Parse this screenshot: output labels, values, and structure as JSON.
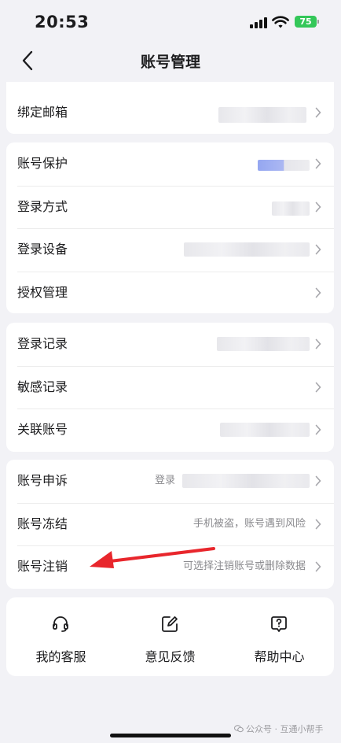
{
  "status_bar": {
    "time": "20:53",
    "battery": "75"
  },
  "nav": {
    "title": "账号管理"
  },
  "section_email": {
    "items": [
      {
        "label": "绑定邮箱",
        "value": ""
      }
    ]
  },
  "section_security": {
    "items": [
      {
        "label": "账号保护",
        "value": ""
      },
      {
        "label": "登录方式",
        "value": ""
      },
      {
        "label": "登录设备",
        "value": ""
      },
      {
        "label": "授权管理",
        "value": ""
      }
    ]
  },
  "section_records": {
    "items": [
      {
        "label": "登录记录",
        "value": ""
      },
      {
        "label": "敏感记录",
        "value": ""
      },
      {
        "label": "关联账号",
        "value": ""
      }
    ]
  },
  "section_account": {
    "items": [
      {
        "label": "账号申诉",
        "value": "登录"
      },
      {
        "label": "账号冻结",
        "value": "手机被盗，账号遇到风险"
      },
      {
        "label": "账号注销",
        "value": "可选择注销账号或删除数据"
      }
    ]
  },
  "actions": [
    {
      "label": "我的客服",
      "icon": "headset-icon"
    },
    {
      "label": "意见反馈",
      "icon": "edit-icon"
    },
    {
      "label": "帮助中心",
      "icon": "help-icon"
    }
  ],
  "watermark": {
    "text": "公众号 · 互通小帮手"
  },
  "colors": {
    "background": "#f2f2f6",
    "battery": "#34c759",
    "annotation_arrow": "#e8262c"
  }
}
